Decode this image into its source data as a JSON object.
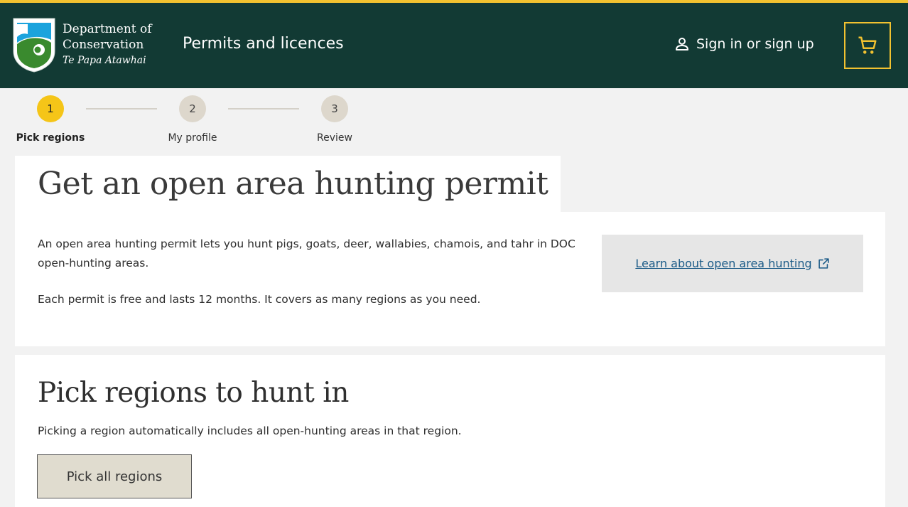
{
  "brand": {
    "line1": "Department of",
    "line2": "Conservation",
    "line3": "Te Papa Atawhai",
    "colors": {
      "header_bg": "#123a34",
      "accent": "#f2c230",
      "shield_blue": "#1aa3dd",
      "shield_green": "#3a8a2e"
    }
  },
  "header": {
    "site_title": "Permits and licences",
    "signin_label": "Sign in or sign up",
    "signin_icon": "person-icon",
    "cart_icon": "cart-icon"
  },
  "stepper": {
    "steps": [
      {
        "number": "1",
        "label": "Pick regions",
        "state": "active"
      },
      {
        "number": "2",
        "label": "My profile",
        "state": "inactive"
      },
      {
        "number": "3",
        "label": "Review",
        "state": "inactive"
      }
    ]
  },
  "main": {
    "title": "Get an open area hunting permit",
    "intro_p1": "An open area hunting permit lets you hunt pigs, goats, deer, wallabies, chamois, and tahr in DOC open-hunting areas.",
    "intro_p2": "Each permit is free and lasts 12 months. It covers as many regions as you need.",
    "learn_link": "Learn about open area hunting",
    "learn_icon": "external-link-icon"
  },
  "regions": {
    "title": "Pick regions to hunt in",
    "description": "Picking a region automatically includes all open-hunting areas in that region.",
    "pick_all_label": "Pick all regions"
  }
}
